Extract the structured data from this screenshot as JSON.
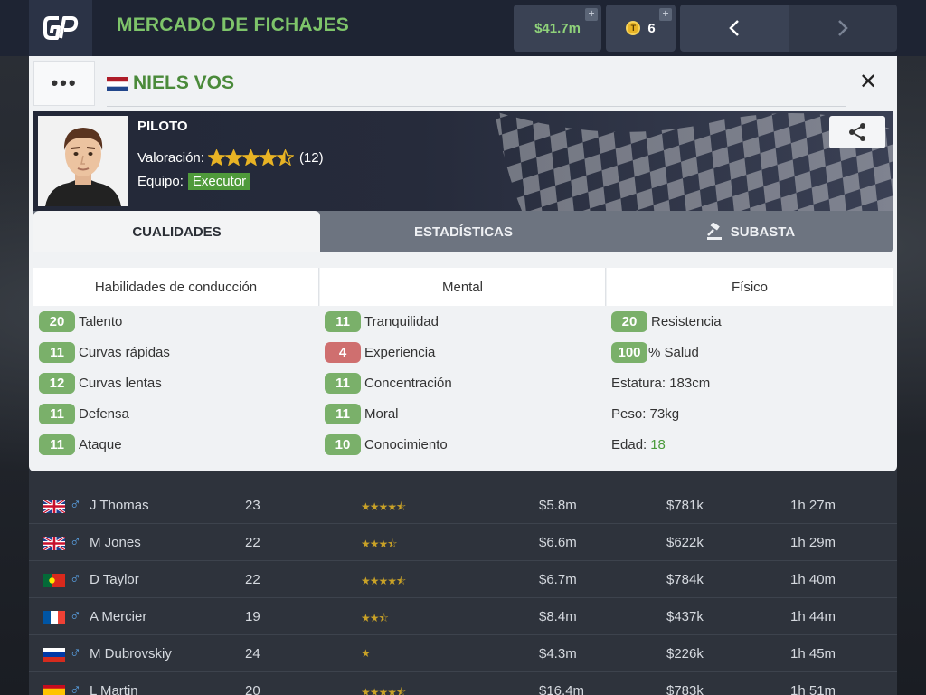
{
  "header": {
    "title": "MERCADO DE FICHAJES",
    "money": "$41.7m",
    "tokens": "6",
    "plus": "+"
  },
  "driver": {
    "name": "NIELS VOS",
    "role": "PILOTO",
    "rating_label": "Valoración:",
    "rating_count": "(12)",
    "rating_stars": 4.5,
    "team_label": "Equipo:",
    "team": "Executor"
  },
  "tabs": [
    "CUALIDADES",
    "ESTADÍSTICAS",
    "SUBASTA"
  ],
  "qualities": {
    "driving": {
      "title": "Habilidades de conducción",
      "items": [
        {
          "value": "20",
          "label": "Talento",
          "tone": "green"
        },
        {
          "value": "11",
          "label": "Curvas rápidas",
          "tone": "green"
        },
        {
          "value": "12",
          "label": "Curvas lentas",
          "tone": "green"
        },
        {
          "value": "11",
          "label": "Defensa",
          "tone": "green"
        },
        {
          "value": "11",
          "label": "Ataque",
          "tone": "green"
        }
      ]
    },
    "mental": {
      "title": "Mental",
      "items": [
        {
          "value": "11",
          "label": "Tranquilidad",
          "tone": "green"
        },
        {
          "value": "4",
          "label": "Experiencia",
          "tone": "red"
        },
        {
          "value": "11",
          "label": "Concentración",
          "tone": "green"
        },
        {
          "value": "11",
          "label": "Moral",
          "tone": "green"
        },
        {
          "value": "10",
          "label": "Conocimiento",
          "tone": "green"
        }
      ]
    },
    "physical": {
      "title": "Físico",
      "stamina": {
        "value": "20",
        "label": "Resistencia"
      },
      "health": {
        "value": "100",
        "label": "% Salud"
      },
      "height": "Estatura: 183cm",
      "weight": "Peso: 73kg",
      "age_label": "Edad:",
      "age": "18"
    }
  },
  "market_rows": [
    {
      "name": "J Thomas",
      "age": "23",
      "stars": "★★★★⯪",
      "value": "$5.8m",
      "salary": "$781k",
      "time": "1h 27m",
      "flag": "gb"
    },
    {
      "name": "M Jones",
      "age": "22",
      "stars": "★★★⯪",
      "value": "$6.6m",
      "salary": "$622k",
      "time": "1h 29m",
      "flag": "gb"
    },
    {
      "name": "D Taylor",
      "age": "22",
      "stars": "★★★★⯪",
      "value": "$6.7m",
      "salary": "$784k",
      "time": "1h 40m",
      "flag": "pt"
    },
    {
      "name": "A Mercier",
      "age": "19",
      "stars": "★★⯪",
      "value": "$8.4m",
      "salary": "$437k",
      "time": "1h 44m",
      "flag": "fr"
    },
    {
      "name": "M Dubrovskiy",
      "age": "24",
      "stars": "★",
      "value": "$4.3m",
      "salary": "$226k",
      "time": "1h 45m",
      "flag": "ru"
    },
    {
      "name": "L Martin",
      "age": "20",
      "stars": "★★★★⯪",
      "value": "$16.4m",
      "salary": "$783k",
      "time": "1h 51m",
      "flag": "es"
    }
  ],
  "colors": {
    "accent_green": "#7ec46a",
    "pill_green": "#7ab06a",
    "pill_red": "#cf6f6f",
    "star_gold": "#e8b324"
  }
}
